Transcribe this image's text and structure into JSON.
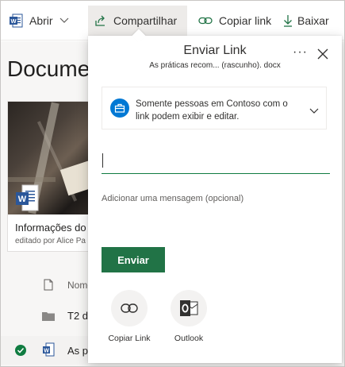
{
  "toolbar": {
    "open_label": "Abrir",
    "share_label": "Compartilhar",
    "copy_link_label": "Copiar link",
    "download_label": "Baixar"
  },
  "library": {
    "title": "Documentos",
    "card": {
      "name": "Informações do",
      "subtitle": "editado por Alice Pa"
    },
    "list": {
      "header_name": "Nome",
      "rows": [
        {
          "label": "T2 d"
        },
        {
          "label": "As p"
        }
      ]
    }
  },
  "panel": {
    "title": "Enviar Link",
    "filename": "As práticas recom... (rascunho). docx",
    "more": "···",
    "scope_text": "Somente pessoas em Contoso com o link podem exibir e editar.",
    "to_value": "",
    "message_placeholder": "Adicionar uma mensagem (opcional)",
    "send_label": "Enviar",
    "options": [
      {
        "label": "Copiar Link",
        "icon": "link-icon"
      },
      {
        "label": "Outlook",
        "icon": "outlook-icon"
      }
    ]
  },
  "colors": {
    "accent_green": "#217346",
    "accent_blue": "#0078d4",
    "word_blue": "#2b579a",
    "outlook_blue": "#0072c6"
  }
}
